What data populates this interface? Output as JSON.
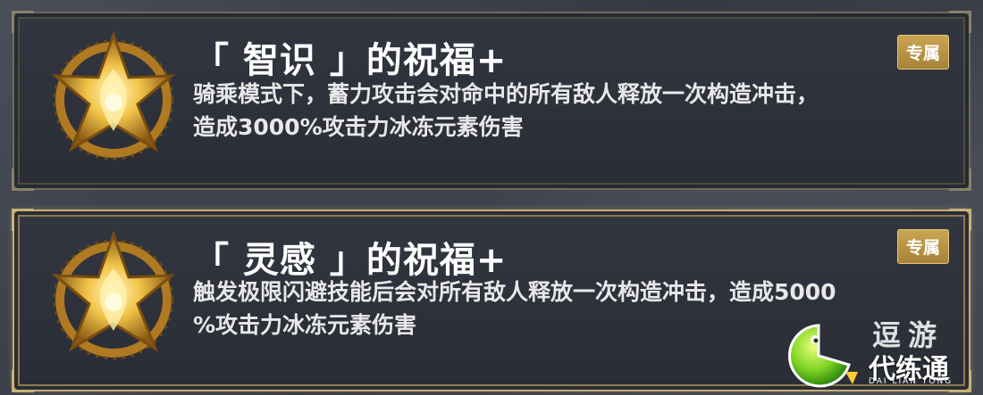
{
  "cards": [
    {
      "title": "「 智识 」的祝福+",
      "badge": "专属",
      "desc_line1": "骑乘模式下，蓄力攻击会对命中的所有敌人释放一次构造冲击，",
      "desc_line2": "造成3000%攻击力冰冻元素伤害",
      "state": "normal"
    },
    {
      "title": "「 灵感 」的祝福+",
      "badge": "专属",
      "desc_line1": "触发极限闪避技能后会对所有敌人释放一次构造冲击，造成5000",
      "desc_line2": "%攻击力冰冻元素伤害",
      "state": "selected"
    }
  ],
  "watermark": {
    "name": "代练通",
    "sub": "DAI LIAN TONG",
    "partial": "逗游"
  },
  "colors": {
    "gold": "#c9a552",
    "card_bg": "#2d3038",
    "selected_border": "#c7ad72"
  },
  "icons": [
    "golden-star-emblem-icon",
    "daliantong-logo-icon"
  ]
}
